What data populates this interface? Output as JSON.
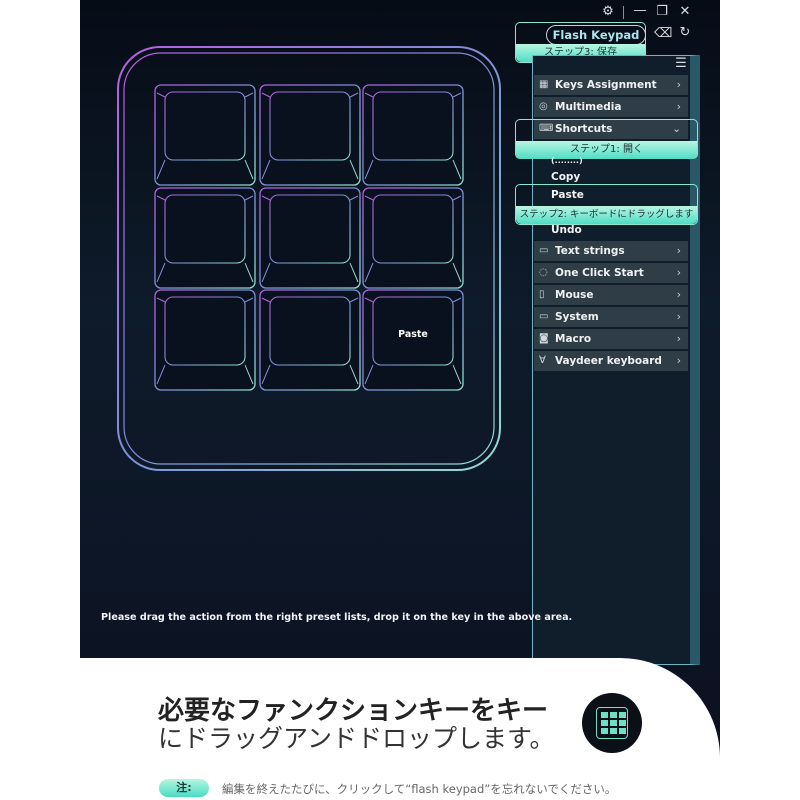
{
  "window": {
    "icons": [
      "gear-icon",
      "minimize-icon",
      "restore-icon",
      "close-icon"
    ]
  },
  "toolbar": {
    "flash_label": "Flash Keypad",
    "step3": "ステップ3: 保存"
  },
  "keypad": {
    "keys": [
      "",
      "",
      "",
      "",
      "",
      "",
      "",
      "",
      "Paste"
    ]
  },
  "sidebar": {
    "items_top": [
      {
        "label": "Keys Assignment",
        "icon": "grid-icon"
      },
      {
        "label": "Multimedia",
        "icon": "media-icon"
      },
      {
        "label": "Shortcuts",
        "icon": "shortcut-icon",
        "expanded": true
      }
    ],
    "step1": "ステップ1: 開く",
    "sub_items": [
      "(........)",
      "Copy",
      "Paste",
      "Undo"
    ],
    "step2": "ステップ2: キーボードにドラッグします",
    "items_bottom": [
      {
        "label": "Text strings",
        "icon": "text-icon"
      },
      {
        "label": "One Click Start",
        "icon": "click-icon"
      },
      {
        "label": "Mouse",
        "icon": "mouse-icon"
      },
      {
        "label": "System",
        "icon": "monitor-icon"
      },
      {
        "label": "Macro",
        "icon": "macro-icon"
      },
      {
        "label": "Vaydeer keyboard",
        "icon": "vaydeer-icon"
      }
    ]
  },
  "instruction": "Please drag the action from the right preset lists, drop it on the key in the above area.",
  "caption": {
    "line1": "必要なファンクションキーをキー",
    "line2": "にドラッグアンドドロップします。",
    "note_label": "注:",
    "note": "編集を終えたたびに、クリックして“flash keypad”を忘れないでください。"
  },
  "colors": {
    "accent": "#4fdcc5",
    "bg": "#0b1422"
  }
}
